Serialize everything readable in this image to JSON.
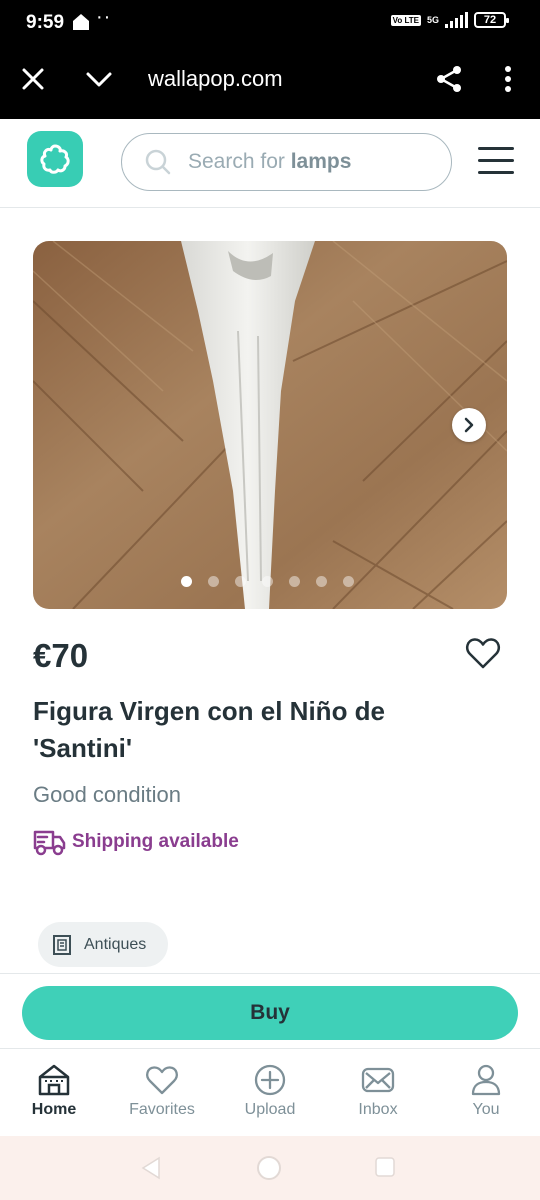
{
  "status_bar": {
    "time": "9:59",
    "dots": "··",
    "volte": "Vo LTE",
    "network": "5G",
    "battery": "72"
  },
  "browser": {
    "url": "wallapop.com"
  },
  "header": {
    "search_placeholder_prefix": "Search for ",
    "search_placeholder_keyword": "lamps"
  },
  "carousel": {
    "total_images": 7,
    "current_index": 1
  },
  "product": {
    "price": "€70",
    "title": "Figura Virgen con el Niño de 'Santini'",
    "condition": "Good condition",
    "shipping": "Shipping available",
    "category": "Antiques"
  },
  "actions": {
    "buy_label": "Buy"
  },
  "bottom_nav": {
    "items": [
      {
        "label": "Home",
        "icon": "home-icon",
        "active": true
      },
      {
        "label": "Favorites",
        "icon": "heart-icon",
        "active": false
      },
      {
        "label": "Upload",
        "icon": "plus-circle-icon",
        "active": false
      },
      {
        "label": "Inbox",
        "icon": "envelope-icon",
        "active": false
      },
      {
        "label": "You",
        "icon": "user-icon",
        "active": false
      }
    ]
  },
  "colors": {
    "brand": "#38cdb4",
    "buy_button": "#3fd0b8",
    "shipping": "#8a3d8f",
    "text_dark": "#253238"
  }
}
